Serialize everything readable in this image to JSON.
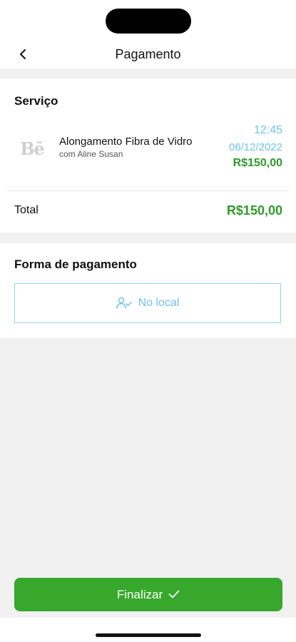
{
  "header": {
    "title": "Pagamento",
    "back_icon": "chevron-left-icon"
  },
  "service": {
    "section_title": "Serviço",
    "logo_text": "Bē",
    "name": "Alongamento Fibra de Vidro",
    "professional": "com Aline Susan",
    "time": "12:45",
    "date": "06/12/2022",
    "price": "R$150,00",
    "total_label": "Total",
    "total_value": "R$150,00"
  },
  "payment": {
    "section_title": "Forma de pagamento",
    "option_label": "No local",
    "option_icon": "user-check-icon"
  },
  "footer": {
    "finalize_label": "Finalizar",
    "finalize_icon": "check-icon"
  },
  "colors": {
    "accent_blue": "#6fc3e5",
    "price_green": "#2f9a2a",
    "button_green": "#37a82b"
  }
}
